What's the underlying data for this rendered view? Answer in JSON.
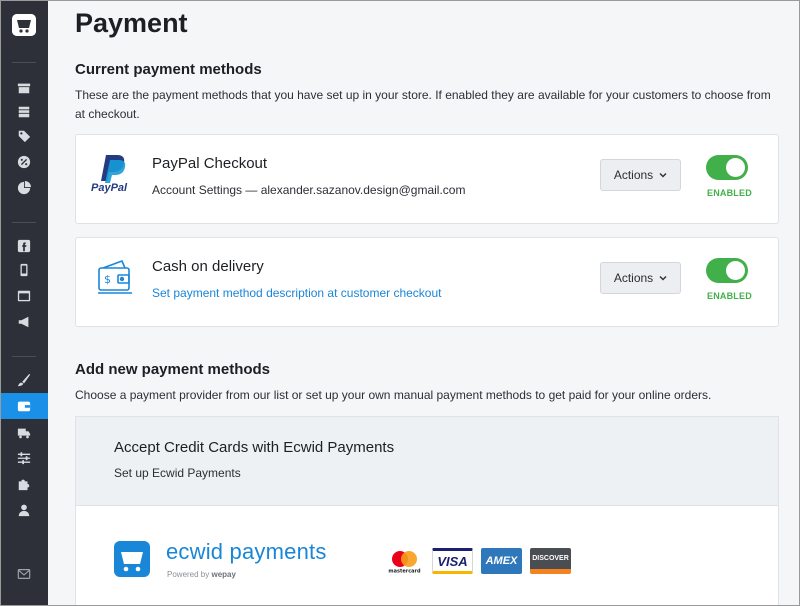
{
  "page": {
    "title": "Payment"
  },
  "current": {
    "title": "Current payment methods",
    "description": "These are the payment methods that you have set up in your store. If enabled they are available for your customers to choose from at checkout."
  },
  "methods": [
    {
      "name": "PayPal Checkout",
      "detail": "Account Settings — alexander.sazanov.design@gmail.com",
      "logo_text": "PayPal",
      "actions_label": "Actions",
      "enabled": true,
      "status_label": "ENABLED"
    },
    {
      "name": "Cash on delivery",
      "detail": "Set payment method description at customer checkout",
      "actions_label": "Actions",
      "enabled": true,
      "status_label": "ENABLED"
    }
  ],
  "add": {
    "title": "Add new payment methods",
    "description": "Choose a payment provider from our list or set up your own manual payment methods to get paid for your online orders."
  },
  "promo": {
    "title": "Accept Credit Cards with Ecwid Payments",
    "subtitle": "Set up Ecwid Payments",
    "brand": "ecwid payments",
    "powered_prefix": "Powered by",
    "powered_brand": "wepay",
    "cards": [
      {
        "name": "mastercard",
        "label": "mastercard"
      },
      {
        "name": "visa",
        "label": "VISA"
      },
      {
        "name": "amex",
        "label": "AMEX"
      },
      {
        "name": "discover",
        "label": "DISCOVER"
      }
    ]
  },
  "sidebar": {
    "items": [
      {
        "icon": "store-icon"
      },
      {
        "icon": "catalog-icon"
      },
      {
        "icon": "tag-icon"
      },
      {
        "icon": "discount-icon"
      },
      {
        "icon": "reports-icon"
      },
      {
        "icon": "facebook-icon"
      },
      {
        "icon": "mobile-icon"
      },
      {
        "icon": "website-icon"
      },
      {
        "icon": "megaphone-icon"
      },
      {
        "icon": "brush-icon"
      },
      {
        "icon": "wallet-icon",
        "active": true
      },
      {
        "icon": "truck-icon"
      },
      {
        "icon": "settings-sliders-icon"
      },
      {
        "icon": "puzzle-icon"
      },
      {
        "icon": "user-icon"
      },
      {
        "icon": "mail-icon"
      }
    ]
  },
  "colors": {
    "sidebar_bg": "#2d3038",
    "accent": "#1a90e8",
    "link": "#1a86d8",
    "enabled_green": "#41b04a"
  }
}
